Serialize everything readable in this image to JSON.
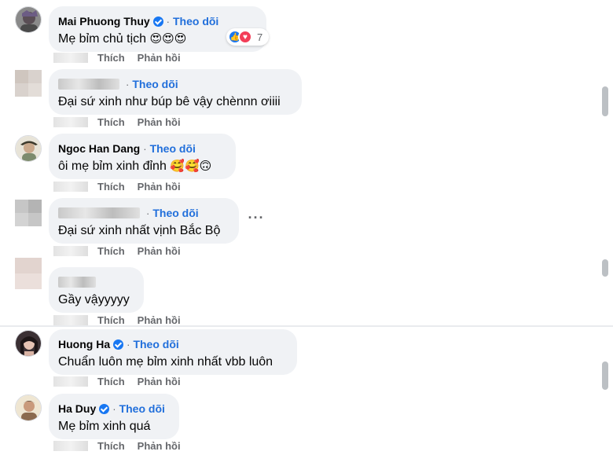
{
  "follow_label": "Theo dõi",
  "action_like": "Thích",
  "action_reply": "Phản hồi",
  "comments": [
    {
      "name": "Mai Phuong Thuy",
      "verified": true,
      "text": "Mẹ bỉm chủ tịch",
      "emojis": "😍😍😍",
      "reactions": {
        "icons": [
          "like-icon",
          "love-icon"
        ],
        "count": "7"
      }
    },
    {
      "name": "",
      "verified": false,
      "text": "Đại sứ xinh như búp bê vậy chènnn ơiiii",
      "emojis": ""
    },
    {
      "name": "Ngoc Han Dang",
      "verified": false,
      "text": "ôi mẹ bỉm xinh đỉnh",
      "emojis": "🥰🥰🙃"
    },
    {
      "name": "",
      "verified": false,
      "text": "Đại sứ xinh nhất vịnh Bắc Bộ",
      "emojis": ""
    },
    {
      "name": "",
      "verified": false,
      "text": "Gầy vậyyyyy",
      "emojis": ""
    },
    {
      "name": "Huong Ha",
      "verified": true,
      "text": "Chuẩn luôn mẹ bỉm xinh nhất vbb luôn",
      "emojis": ""
    },
    {
      "name": "Ha Duy",
      "verified": true,
      "text": "Mẹ bỉm xinh quá",
      "emojis": ""
    }
  ],
  "more_icon": "more-horizontal-icon",
  "colors": {
    "bubble": "#f0f2f5",
    "follow": "#216fdb",
    "meta": "#65676b",
    "verified": "#1877f2"
  }
}
